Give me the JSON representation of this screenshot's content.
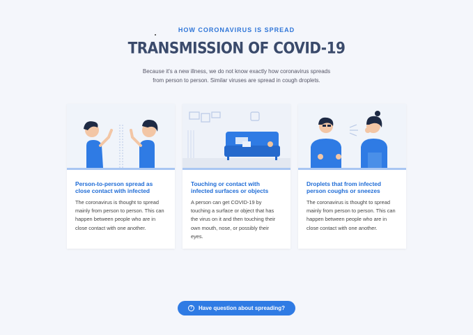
{
  "header": {
    "eyebrow": "HOW CORONAVIRUS IS SPREAD",
    "title": "TRANSMISSION OF COVID-19",
    "intro_line1": "Because it's a new illness, we do not know exactly how coronavirus spreads",
    "intro_line2": "from person to person. Similar viruses are spread in cough droplets."
  },
  "cards": [
    {
      "title": "Person-to-person spread as close contact with infected",
      "text": "The coronavirus is thought to spread mainly from person to person. This can happen between people who are in close contact with one another."
    },
    {
      "title": "Touching or contact with infected surfaces or objects",
      "text": "A person can get COVID-19 by touching a surface or object that has the virus on it and then touching their own mouth, nose, or possibly their eyes."
    },
    {
      "title": "Droplets that from infected person coughs or sneezes",
      "text": "The coronavirus is thought to spread mainly from person to person. This can happen between people who are in close contact with one another."
    }
  ],
  "cta": {
    "label": "Have question about spreading?",
    "icon": "question-circle-icon"
  },
  "colors": {
    "accent": "#2f7be4",
    "title_blue": "#1f6cd6",
    "headline": "#3a4a6b",
    "background": "#f4f6fb"
  }
}
